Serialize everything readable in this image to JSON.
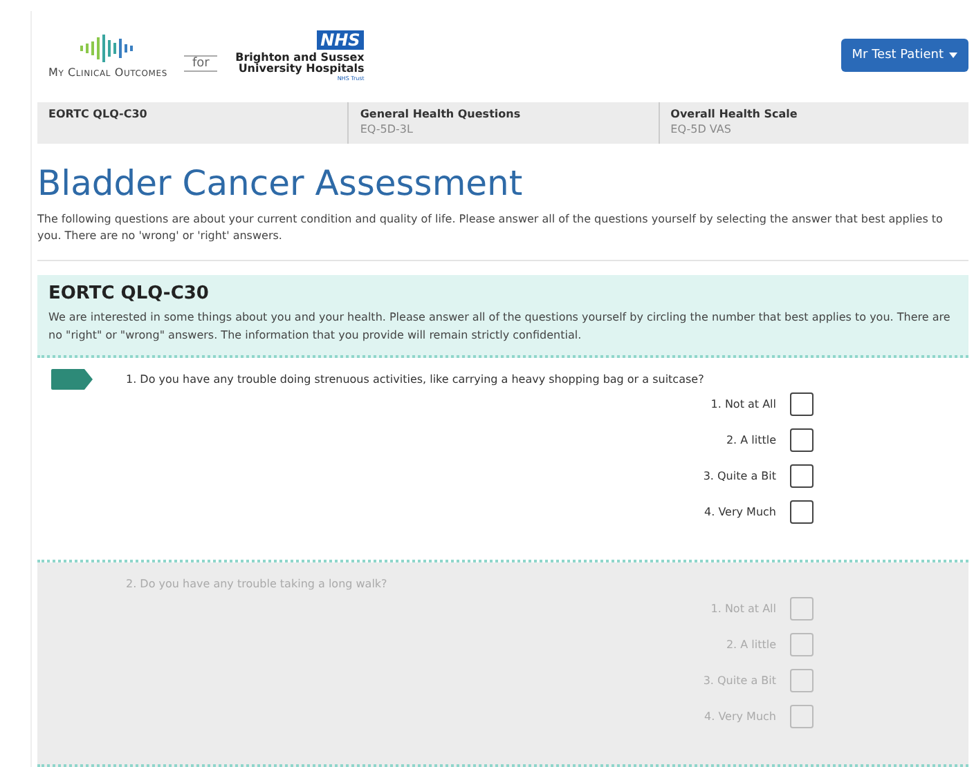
{
  "header": {
    "brand": "My Clinical Outcomes",
    "for": "for",
    "trust_badge": "NHS",
    "trust_name": "Brighton and Sussex University Hospitals",
    "trust_sub": "NHS Trust",
    "user_button": "Mr Test Patient"
  },
  "steps": [
    {
      "title": "EORTC QLQ-C30"
    },
    {
      "title": "General Health Questions",
      "subtitle": "EQ-5D-3L"
    },
    {
      "title": "Overall Health Scale",
      "subtitle": "EQ-5D VAS"
    }
  ],
  "page_title": "Bladder Cancer Assessment",
  "intro": "The following questions are about your current condition and quality of life. Please answer all of the questions yourself by selecting the answer that best applies to you. There are no 'wrong' or 'right' answers.",
  "section": {
    "title": "EORTC QLQ-C30",
    "description": "We are interested in some things about you and your health. Please answer all of the questions yourself by circling the number that best applies to you. There are no \"right\" or \"wrong\" answers. The information that you provide will remain strictly confidential."
  },
  "questions": [
    {
      "text": "1. Do you have any trouble doing strenuous activities, like carrying a heavy shopping bag or a suitcase?",
      "current": true,
      "disabled": false,
      "options": [
        {
          "label": "1. Not at All",
          "checked": false
        },
        {
          "label": "2. A little",
          "checked": false
        },
        {
          "label": "3. Quite a Bit",
          "checked": false
        },
        {
          "label": "4. Very Much",
          "checked": false
        }
      ]
    },
    {
      "text": "2. Do you have any trouble taking a long walk?",
      "current": false,
      "disabled": true,
      "options": [
        {
          "label": "1. Not at All",
          "checked": false
        },
        {
          "label": "2. A little",
          "checked": false
        },
        {
          "label": "3. Quite a Bit",
          "checked": false
        },
        {
          "label": "4. Very Much",
          "checked": false
        }
      ]
    }
  ]
}
